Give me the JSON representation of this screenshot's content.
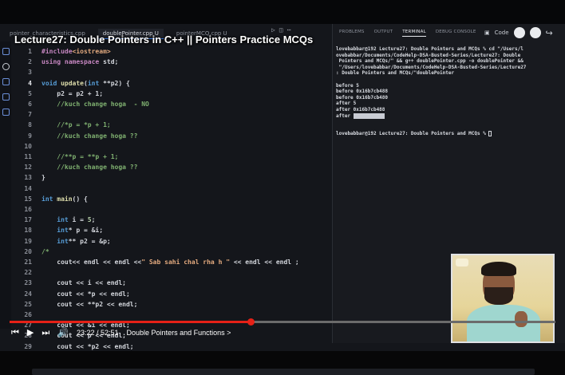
{
  "video": {
    "title": "Lecture27: Double Pointers in C++ || Pointers Practice MCQs",
    "time": "23:22 / 52:51",
    "chapter": "Double Pointers and Functions >",
    "progress": 0.442
  },
  "editor": {
    "tabs": [
      {
        "label": "pointer_characteristics.cpp",
        "active": false
      },
      {
        "label": "doublePointer.cpp  U",
        "active": true
      },
      {
        "label": "pointerMCQ.cpp  U",
        "active": false
      }
    ],
    "code": [
      {
        "n": "1",
        "t": [
          [
            "inc",
            "#include"
          ],
          [
            "str",
            "<iostream>"
          ]
        ]
      },
      {
        "n": "2",
        "t": [
          [
            "kw",
            "using namespace "
          ],
          [
            "src",
            "std;"
          ]
        ]
      },
      {
        "n": "3",
        "t": []
      },
      {
        "n": "4",
        "t": [
          [
            "ty",
            "void "
          ],
          [
            "fn",
            "update"
          ],
          [
            "src",
            "("
          ],
          [
            "ty",
            "int "
          ],
          [
            "src",
            "**p2) {"
          ]
        ]
      },
      {
        "n": "5",
        "t": [
          [
            "src",
            "    p2 = p2 + 1;"
          ]
        ]
      },
      {
        "n": "6",
        "t": [
          [
            "cmt",
            "    //kuch change hoga  - NO"
          ]
        ]
      },
      {
        "n": "7",
        "t": []
      },
      {
        "n": "8",
        "t": [
          [
            "cmt",
            "    //*p = *p + 1;"
          ]
        ]
      },
      {
        "n": "9",
        "t": [
          [
            "cmt",
            "    //kuch change hoga ??"
          ]
        ]
      },
      {
        "n": "10",
        "t": []
      },
      {
        "n": "11",
        "t": [
          [
            "cmt",
            "    //**p = **p + 1;"
          ]
        ]
      },
      {
        "n": "12",
        "t": [
          [
            "cmt",
            "    //kuch change hoga ??"
          ]
        ]
      },
      {
        "n": "13",
        "t": [
          [
            "src",
            "}"
          ]
        ]
      },
      {
        "n": "14",
        "t": []
      },
      {
        "n": "15",
        "t": [
          [
            "ty",
            "int "
          ],
          [
            "fn",
            "main"
          ],
          [
            "src",
            "() {"
          ]
        ]
      },
      {
        "n": "16",
        "t": []
      },
      {
        "n": "17",
        "t": [
          [
            "ty",
            "    int "
          ],
          [
            "src",
            "i = "
          ],
          [
            "num",
            "5"
          ],
          [
            "src",
            ";"
          ]
        ]
      },
      {
        "n": "18",
        "t": [
          [
            "ty",
            "    int"
          ],
          [
            "src",
            "* p = &i;"
          ]
        ]
      },
      {
        "n": "19",
        "t": [
          [
            "ty",
            "    int"
          ],
          [
            "src",
            "** p2 = &p;"
          ]
        ]
      },
      {
        "n": "20",
        "t": [
          [
            "cmt",
            "/*"
          ]
        ]
      },
      {
        "n": "21",
        "t": [
          [
            "src",
            "    cout<< endl << endl <<"
          ],
          [
            "str",
            "\" Sab sahi chal rha h \""
          ],
          [
            "src",
            " << endl << endl ;"
          ]
        ]
      },
      {
        "n": "22",
        "t": []
      },
      {
        "n": "23",
        "t": [
          [
            "src",
            "    cout << i << endl;"
          ]
        ]
      },
      {
        "n": "24",
        "t": [
          [
            "src",
            "    cout << *p << endl;"
          ]
        ]
      },
      {
        "n": "25",
        "t": [
          [
            "src",
            "    cout << **p2 << endl;"
          ]
        ]
      },
      {
        "n": "26",
        "t": []
      },
      {
        "n": "27",
        "t": [
          [
            "src",
            "    cout << &i << endl;"
          ]
        ]
      },
      {
        "n": "28",
        "t": [
          [
            "src",
            "    cout << p << endl;"
          ]
        ]
      },
      {
        "n": "29",
        "t": [
          [
            "src",
            "    cout << *p2 << endl;"
          ]
        ]
      }
    ]
  },
  "panel": {
    "tabs": [
      "PROBLEMS",
      "OUTPUT",
      "TERMINAL",
      "DEBUG CONSOLE"
    ],
    "active_tab": "TERMINAL",
    "tool_label": "Code",
    "terminal": [
      "lovebabbar@192 Lecture27: Double Pointers and MCQs % cd \"/Users/l",
      "ovebabbar/Documents/CodeHelp-DSA-Busted-Series/Lecture27: Double",
      " Pointers and MCQs/\" && g++ doublePointer.cpp -o doublePointer &&",
      " \"/Users/lovebabbar/Documents/CodeHelp-DSA-Busted-Series/Lecture27",
      ": Double Pointers and MCQs/\"doublePointer",
      "",
      "before 5",
      "before 0x16b7cb488",
      "before 0x16b7cb480",
      "after 5",
      "after 0x16b7cb488",
      "after ",
      "",
      "",
      "lovebabbar@192 Lecture27: Double Pointers and MCQs % "
    ]
  }
}
